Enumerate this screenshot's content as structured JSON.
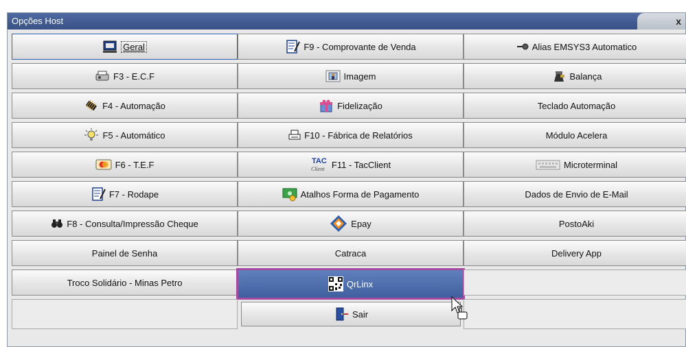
{
  "window": {
    "title": "Opções Host",
    "close_label": "x"
  },
  "buttons": [
    [
      "Geral",
      "F9 - Comprovante de Venda",
      "Alias EMSYS3 Automatico"
    ],
    [
      "F3 - E.C.F",
      "Imagem",
      "Balança"
    ],
    [
      "F4 - Automação",
      "Fidelização",
      "Teclado Automação"
    ],
    [
      "F5 - Automático",
      "F10 - Fábrica de Relatórios",
      "Módulo Acelera"
    ],
    [
      "F6 - T.E.F",
      "F11 - TacClient",
      "Microterminal"
    ],
    [
      "F7 - Rodape",
      "Atalhos Forma de Pagamento",
      "Dados de Envio de E-Mail"
    ],
    [
      "F8 - Consulta/Impressão Cheque",
      "Epay",
      "PostoAki"
    ],
    [
      "Painel de Senha",
      "Catraca",
      "Delivery App"
    ],
    [
      "Troco Solidário - Minas Petro",
      "QrLinx",
      ""
    ]
  ],
  "exit_button": "Sair",
  "icons": {
    "tac_top": "TAC",
    "tac_bottom": "Client"
  },
  "colors": {
    "titlebar": "#3f5a8f",
    "selected": "#4a69a8",
    "selected_outline": "#a44aa0"
  }
}
